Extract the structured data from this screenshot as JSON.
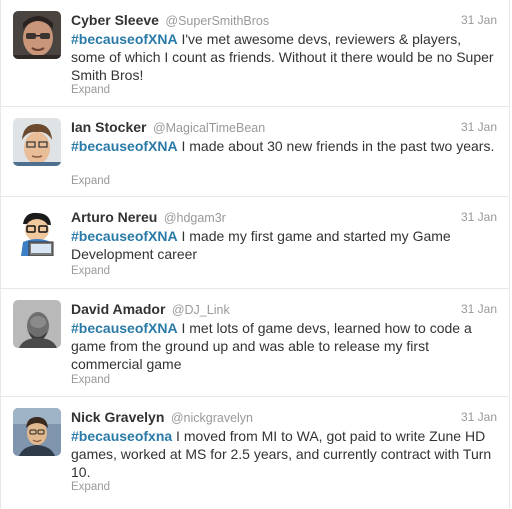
{
  "colors": {
    "hashtag": "#2a7aa8",
    "meta_text": "#999999",
    "body_text": "#333333",
    "border": "#e8e8e8"
  },
  "tweets": [
    {
      "fullname": "Cyber Sleeve",
      "username": "@SuperSmithBros",
      "time": "31 Jan",
      "hashtag": "#becauseofXNA",
      "text": " I've met awesome devs, reviewers & players, some of which I count as friends. Without it there would be no Super Smith Bros!",
      "expand": "Expand"
    },
    {
      "fullname": "Ian Stocker",
      "username": "@MagicalTimeBean",
      "time": "31 Jan",
      "hashtag": "#becauseofXNA",
      "text": " I made about 30 new friends in the past two years.",
      "expand": "Expand"
    },
    {
      "fullname": "Arturo Nereu",
      "username": "@hdgam3r",
      "time": "31 Jan",
      "hashtag": "#becauseofXNA",
      "text": " I made my first game and started my Game Development career",
      "expand": "Expand"
    },
    {
      "fullname": "David Amador",
      "username": "@DJ_Link",
      "time": "31 Jan",
      "hashtag": "#becauseofXNA",
      "text": " I met lots of game devs, learned how to code a game from the ground up and was able to release my first commercial game",
      "expand": "Expand"
    },
    {
      "fullname": "Nick Gravelyn",
      "username": "@nickgravelyn",
      "time": "31 Jan",
      "hashtag": "#becauseofxna",
      "text": " I moved from MI to WA, got paid to write Zune HD games, worked at MS for 2.5 years, and currently contract with Turn 10.",
      "expand": "Expand"
    }
  ]
}
